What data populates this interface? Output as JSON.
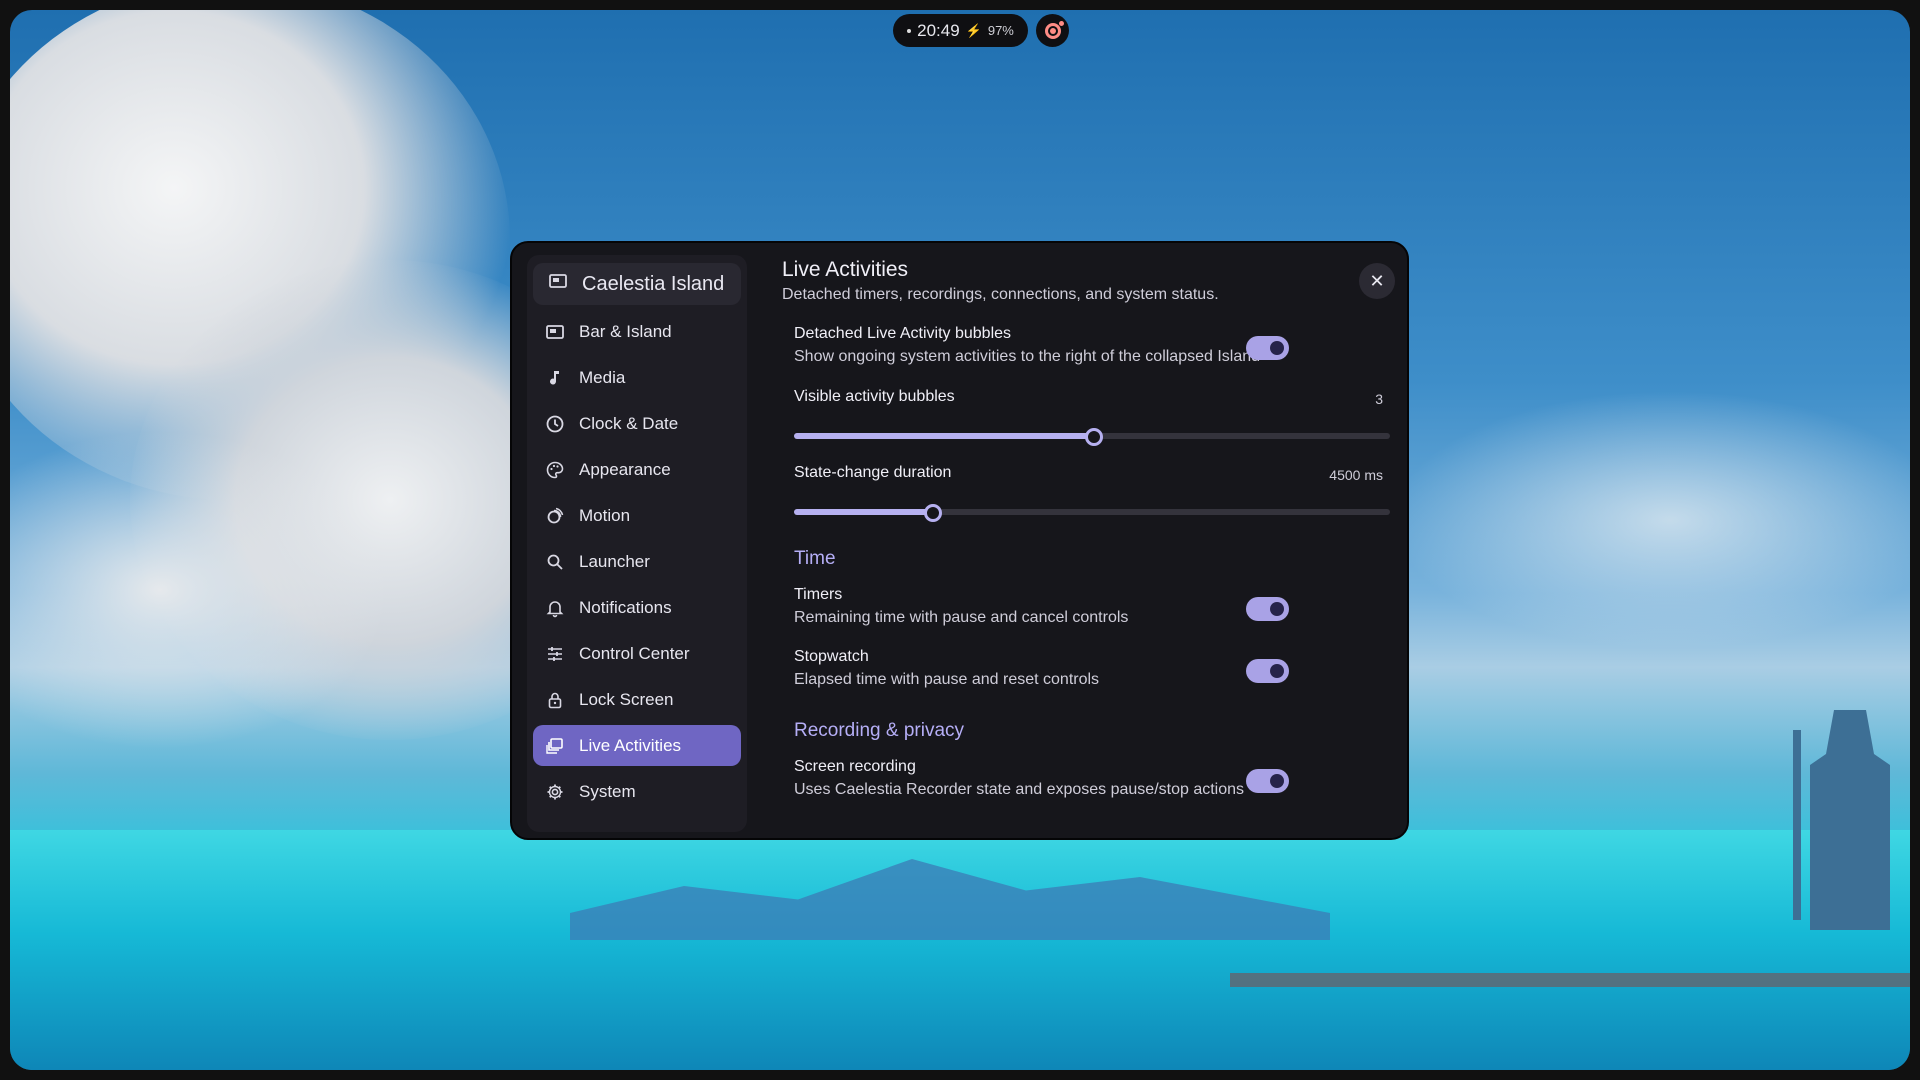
{
  "status": {
    "time": "20:49",
    "battery": "97%"
  },
  "window": {
    "app_title": "Caelestia Island",
    "page_title": "Live Activities",
    "page_subtitle": "Detached timers, recordings, connections, and system status.",
    "close_label": "✕"
  },
  "sidebar": {
    "items": [
      {
        "label": "Bar & Island",
        "icon": "bar-icon"
      },
      {
        "label": "Media",
        "icon": "music-note-icon"
      },
      {
        "label": "Clock & Date",
        "icon": "clock-icon"
      },
      {
        "label": "Appearance",
        "icon": "palette-icon"
      },
      {
        "label": "Motion",
        "icon": "motion-icon"
      },
      {
        "label": "Launcher",
        "icon": "search-icon"
      },
      {
        "label": "Notifications",
        "icon": "bell-icon"
      },
      {
        "label": "Control Center",
        "icon": "sliders-icon"
      },
      {
        "label": "Lock Screen",
        "icon": "lock-icon"
      },
      {
        "label": "Live Activities",
        "icon": "live-activities-icon",
        "active": true
      },
      {
        "label": "System",
        "icon": "gear-icon"
      }
    ]
  },
  "settings": {
    "bubbles": {
      "label": "Detached Live Activity bubbles",
      "desc": "Show ongoing system activities to the right of the collapsed Island",
      "enabled": true
    },
    "visible_bubbles": {
      "label": "Visible activity bubbles",
      "value": "3",
      "fraction": 0.5
    },
    "state_duration": {
      "label": "State-change duration",
      "value": "4500 ms",
      "fraction": 0.23
    },
    "time_section": "Time",
    "timers": {
      "label": "Timers",
      "desc": "Remaining time with pause and cancel controls",
      "enabled": true
    },
    "stopwatch": {
      "label": "Stopwatch",
      "desc": "Elapsed time with pause and reset controls",
      "enabled": true
    },
    "recording_section": "Recording & privacy",
    "screen_recording": {
      "label": "Screen recording",
      "desc": "Uses Caelestia Recorder state and exposes pause/stop actions",
      "enabled": true
    }
  },
  "colors": {
    "accent": "#6f66c3",
    "accent_light": "#b5aef6",
    "panel_bg": "#16161b",
    "sidebar_bg": "#1e1d24",
    "recording": "#ff8c85"
  }
}
